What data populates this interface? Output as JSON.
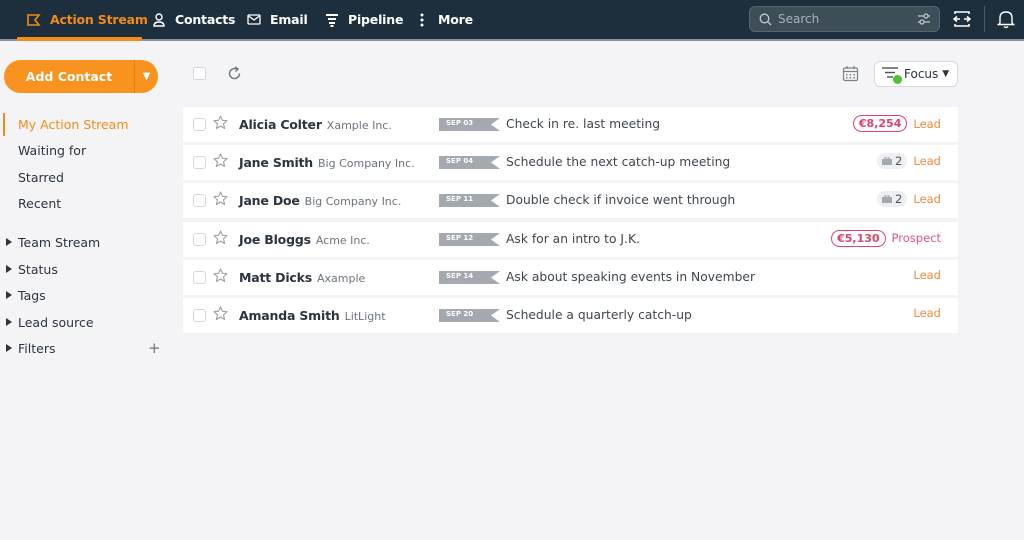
{
  "nav": {
    "items": [
      {
        "label": "Action Stream",
        "icon": "action-stream-icon",
        "active": true
      },
      {
        "label": "Contacts",
        "icon": "contacts-icon",
        "active": false
      },
      {
        "label": "Email",
        "icon": "email-icon",
        "active": false
      },
      {
        "label": "Pipeline",
        "icon": "pipeline-icon",
        "active": false
      },
      {
        "label": "More",
        "icon": "more-icon",
        "active": false
      }
    ],
    "search_placeholder": "Search",
    "accent": "#f28c16",
    "bg": "#1d2e3d"
  },
  "sidebar": {
    "add_contact_label": "Add Contact",
    "stream_items": [
      {
        "label": "My Action Stream",
        "active": true
      },
      {
        "label": "Waiting for",
        "active": false
      },
      {
        "label": "Starred",
        "active": false
      },
      {
        "label": "Recent",
        "active": false
      }
    ],
    "groups": [
      {
        "label": "Team Stream"
      },
      {
        "label": "Status"
      },
      {
        "label": "Tags"
      },
      {
        "label": "Lead source"
      },
      {
        "label": "Filters",
        "has_add": true
      }
    ]
  },
  "toolbar": {
    "focus_label": "Focus"
  },
  "rows": [
    {
      "name": "Alicia Colter",
      "company": "Xample Inc.",
      "date": "SEP 03",
      "task": "Check in re. last meeting",
      "value": "€8,254",
      "count": null,
      "status": "Lead",
      "status_color": "#f0893a"
    },
    {
      "name": "Jane Smith",
      "company": "Big Company Inc.",
      "date": "SEP 04",
      "task": "Schedule the next catch-up meeting",
      "value": null,
      "count": "2",
      "status": "Lead",
      "status_color": "#f0893a"
    },
    {
      "name": "Jane Doe",
      "company": "Big Company Inc.",
      "date": "SEP 11",
      "task": "Double check if invoice went through",
      "value": null,
      "count": "2",
      "status": "Lead",
      "status_color": "#f0893a"
    },
    {
      "name": "Joe Bloggs",
      "company": "Acme Inc.",
      "date": "SEP 12",
      "task": "Ask for an intro to J.K.",
      "value": "€5,130",
      "count": null,
      "status": "Prospect",
      "status_color": "#e0557a"
    },
    {
      "name": "Matt Dicks",
      "company": "Axample",
      "date": "SEP 14",
      "task": "Ask about speaking events in November",
      "value": null,
      "count": null,
      "status": "Lead",
      "status_color": "#f0893a"
    },
    {
      "name": "Amanda Smith",
      "company": "LitLight",
      "date": "SEP 20",
      "task": "Schedule a quarterly catch-up",
      "value": null,
      "count": null,
      "status": "Lead",
      "status_color": "#f0893a"
    }
  ]
}
